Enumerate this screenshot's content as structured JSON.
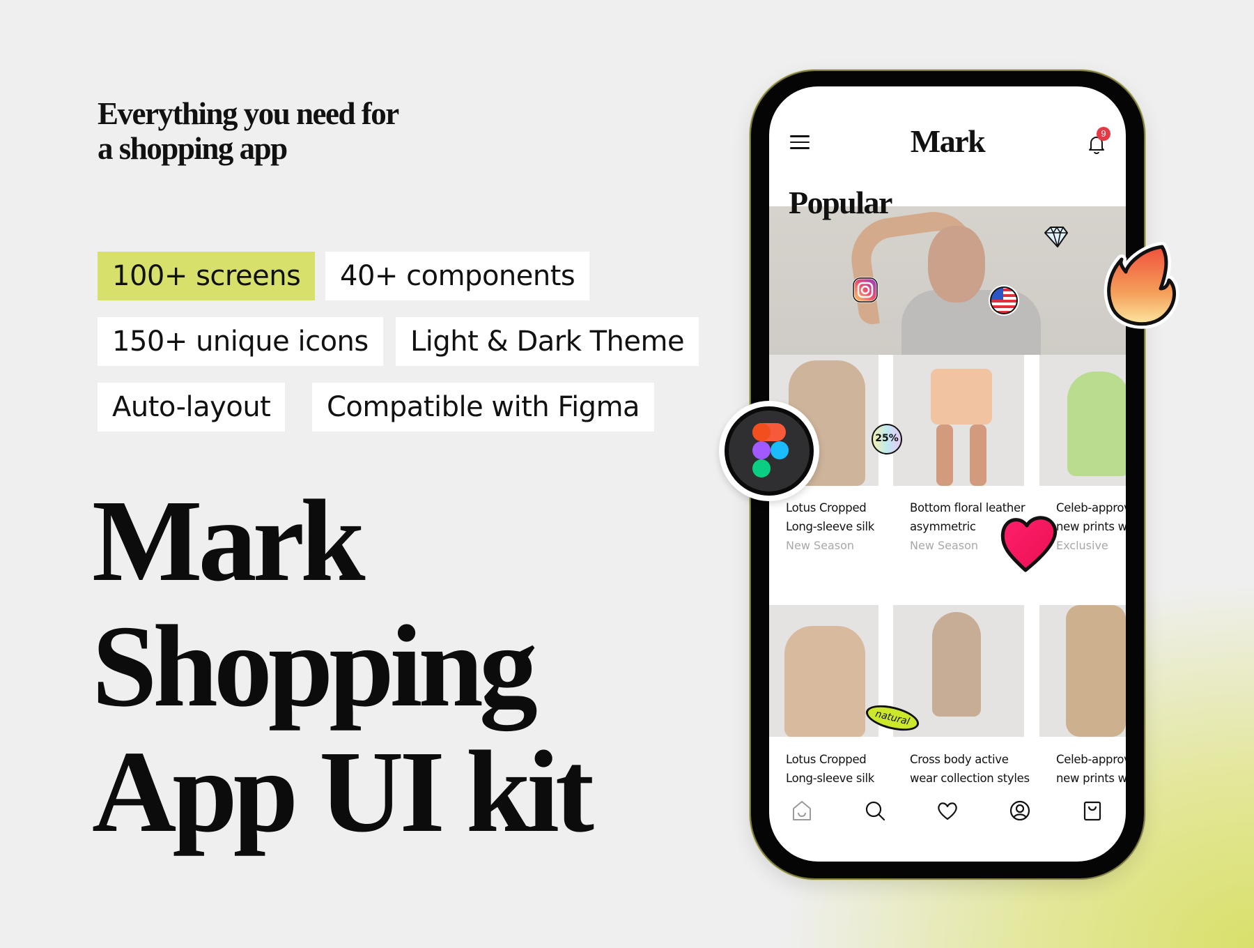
{
  "hero": {
    "tagline_line1": "Everything you need for",
    "tagline_line2": "a shopping app",
    "title_line1": "Mark",
    "title_line2": "Shopping",
    "title_line3": "App UI kit"
  },
  "features": [
    {
      "label": "100+ screens",
      "highlighted": true
    },
    {
      "label": "40+ components",
      "highlighted": false
    },
    {
      "label": "150+ unique icons",
      "highlighted": false
    },
    {
      "label": "Light & Dark Theme",
      "highlighted": false
    },
    {
      "label": "Auto-layout",
      "highlighted": false
    },
    {
      "label": "Compatible with Figma",
      "highlighted": false
    }
  ],
  "colors": {
    "background": "#efefef",
    "accent_green": "#d8e06c",
    "notification_red": "#e53946",
    "subtitle_gray": "#a8a8a8"
  },
  "app": {
    "logo": "Mark",
    "menu_icon": "hamburger-menu-icon",
    "notifications": {
      "icon": "bell-icon",
      "count": "9"
    },
    "section_title": "Popular",
    "products_row1": [
      {
        "title_line1": "Lotus Cropped",
        "title_line2": "Long-sleeve silk",
        "subtitle": "New Season",
        "badge": "25%"
      },
      {
        "title_line1": "Bottom floral leather",
        "title_line2": "asymmetric",
        "subtitle": "New Season"
      },
      {
        "title_line1": "Celeb-approved",
        "title_line2": "new prints with",
        "subtitle": "Exclusive"
      }
    ],
    "products_row2": [
      {
        "title_line1": "Lotus Cropped",
        "title_line2": "Long-sleeve silk",
        "badge": "natural"
      },
      {
        "title_line1": "Cross body active",
        "title_line2": "wear collection styles"
      },
      {
        "title_line1": "Celeb-approved",
        "title_line2": "new prints with"
      }
    ],
    "bottom_nav": [
      {
        "icon": "home-bag-icon",
        "active": true
      },
      {
        "icon": "search-icon",
        "active": false
      },
      {
        "icon": "heart-icon",
        "active": false
      },
      {
        "icon": "user-circle-icon",
        "active": false
      },
      {
        "icon": "shopping-bag-icon",
        "active": false
      }
    ]
  },
  "stickers": [
    "figma-logo",
    "fire",
    "heart",
    "diamond",
    "instagram",
    "usa-flag",
    "25%",
    "natural"
  ]
}
